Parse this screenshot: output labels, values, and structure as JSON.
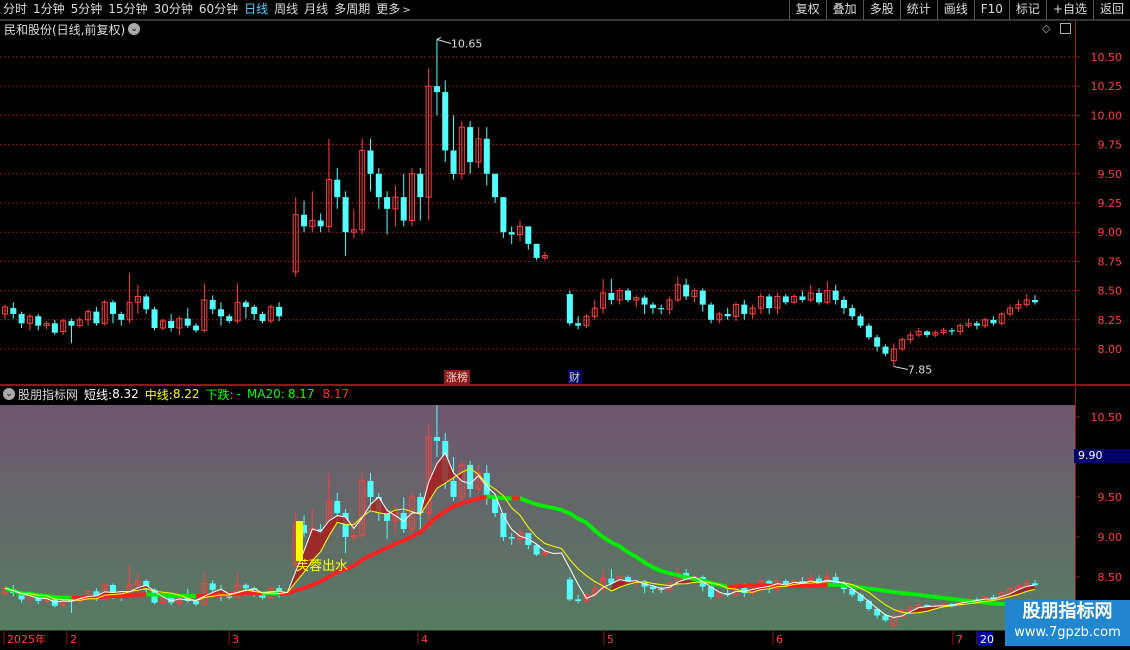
{
  "toolbar": {
    "periods": [
      "分时",
      "1分钟",
      "5分钟",
      "15分钟",
      "30分钟",
      "60分钟",
      "日线",
      "周线",
      "月线",
      "多周期",
      "更多"
    ],
    "active_period": "日线",
    "tools": [
      "复权",
      "叠加",
      "多股",
      "统计",
      "画线",
      "F10",
      "标记",
      "+自选",
      "返回"
    ]
  },
  "main_panel": {
    "title": "民和股份(日线,前复权)",
    "high_label": "10.65",
    "low_label": "7.85",
    "event_labels": [
      "涨榜",
      "财"
    ],
    "y_ticks": [
      "10.50",
      "10.25",
      "10.00",
      "9.75",
      "9.50",
      "9.25",
      "9.00",
      "8.75",
      "8.50",
      "8.25",
      "8.00"
    ]
  },
  "sub_panel": {
    "title": "股朋指标网",
    "legend": [
      {
        "label": "短线:",
        "value": "8.32",
        "color": "#ffffff"
      },
      {
        "label": "中线:",
        "value": "8.22",
        "color": "#ffff00"
      },
      {
        "label": "下跌:",
        "value": "-",
        "color": "#00ff00"
      },
      {
        "label": "MA20:",
        "value": "8.17",
        "color": "#00ff00"
      },
      {
        "label": "",
        "value": "8.17",
        "color": "#ff3333"
      }
    ],
    "annotation": "芙蓉出水",
    "current_price_tag": "9.90",
    "y_ticks": [
      "10.50",
      "10.00",
      "9.50",
      "9.00",
      "8.50"
    ]
  },
  "x_axis": {
    "labels": [
      "2025年",
      "2",
      "3",
      "4",
      "5",
      "6",
      "7",
      "20"
    ]
  },
  "watermark": {
    "line1": "股朋指标网",
    "line2": "www.7gpzb.com"
  },
  "colors": {
    "up": "#ff4040",
    "down": "#54ffff",
    "grid": "#8b1a1a",
    "active": "#5ad0ff"
  }
}
